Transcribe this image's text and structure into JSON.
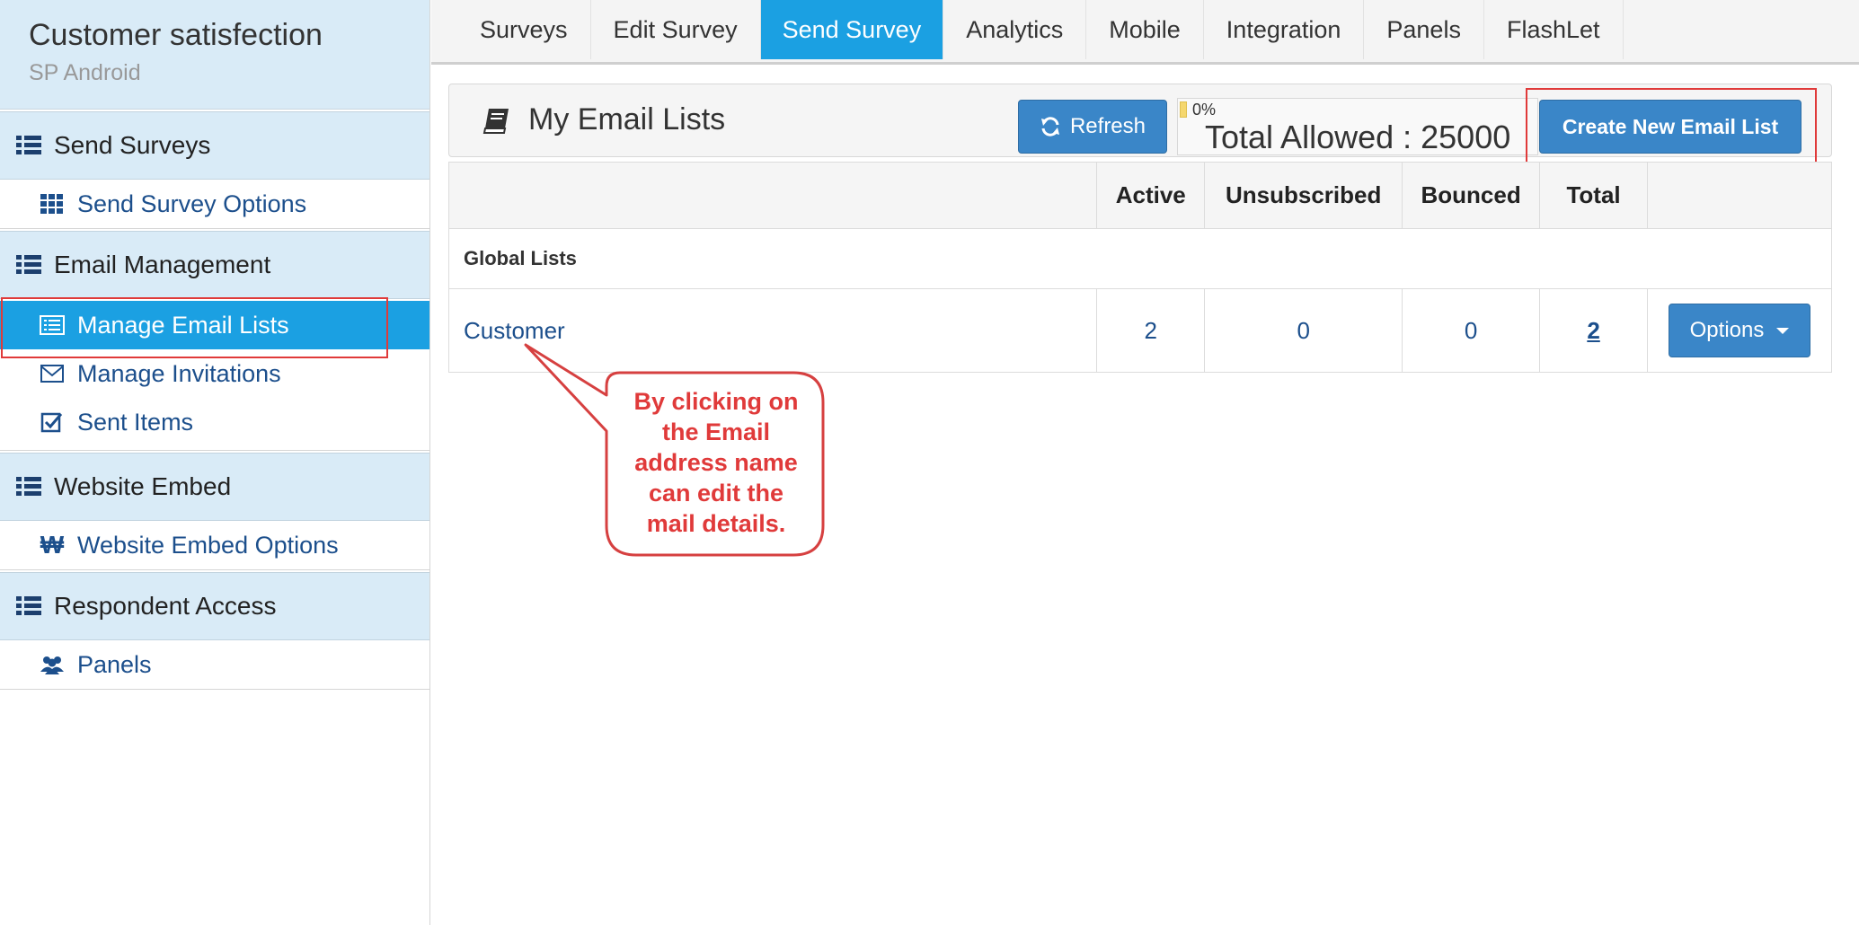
{
  "sidebar": {
    "title": "Customer satisfection",
    "subtitle": "SP Android",
    "sections": [
      {
        "label": "Send Surveys",
        "items": [
          {
            "label": "Send Survey Options",
            "icon": "grid-icon"
          }
        ]
      },
      {
        "label": "Email Management",
        "items": [
          {
            "label": "Manage Email Lists",
            "icon": "list-card-icon",
            "active": true
          },
          {
            "label": "Manage Invitations",
            "icon": "envelope-icon"
          },
          {
            "label": "Sent Items",
            "icon": "check-square-icon"
          }
        ]
      },
      {
        "label": "Website Embed",
        "items": [
          {
            "label": "Website Embed Options",
            "icon": "won-icon"
          }
        ]
      },
      {
        "label": "Respondent Access",
        "items": [
          {
            "label": "Panels",
            "icon": "users-icon"
          }
        ]
      }
    ]
  },
  "tabs": [
    "Surveys",
    "Edit Survey",
    "Send Survey",
    "Analytics",
    "Mobile",
    "Integration",
    "Panels",
    "FlashLet"
  ],
  "active_tab": "Send Survey",
  "panel": {
    "title": "My Email Lists",
    "refresh_label": "Refresh",
    "quota_percent": "0%",
    "quota_fill": 0,
    "quota_text": "Total Allowed : 25000",
    "create_label": "Create New Email List"
  },
  "table": {
    "headers": [
      "",
      "Active",
      "Unsubscribed",
      "Bounced",
      "Total",
      ""
    ],
    "group": "Global Lists",
    "rows": [
      {
        "name": "Customer",
        "active": "2",
        "unsubscribed": "0",
        "bounced": "0",
        "total": "2",
        "action": "Options"
      }
    ]
  },
  "callout": {
    "lines": [
      "By clicking on",
      "the Email",
      "address name",
      "can edit the",
      "mail details."
    ]
  },
  "colors": {
    "accent": "#1ba0e2",
    "button": "#3a86c8",
    "sidebar_bg": "#d9ebf7",
    "highlight": "#e03a3a"
  }
}
